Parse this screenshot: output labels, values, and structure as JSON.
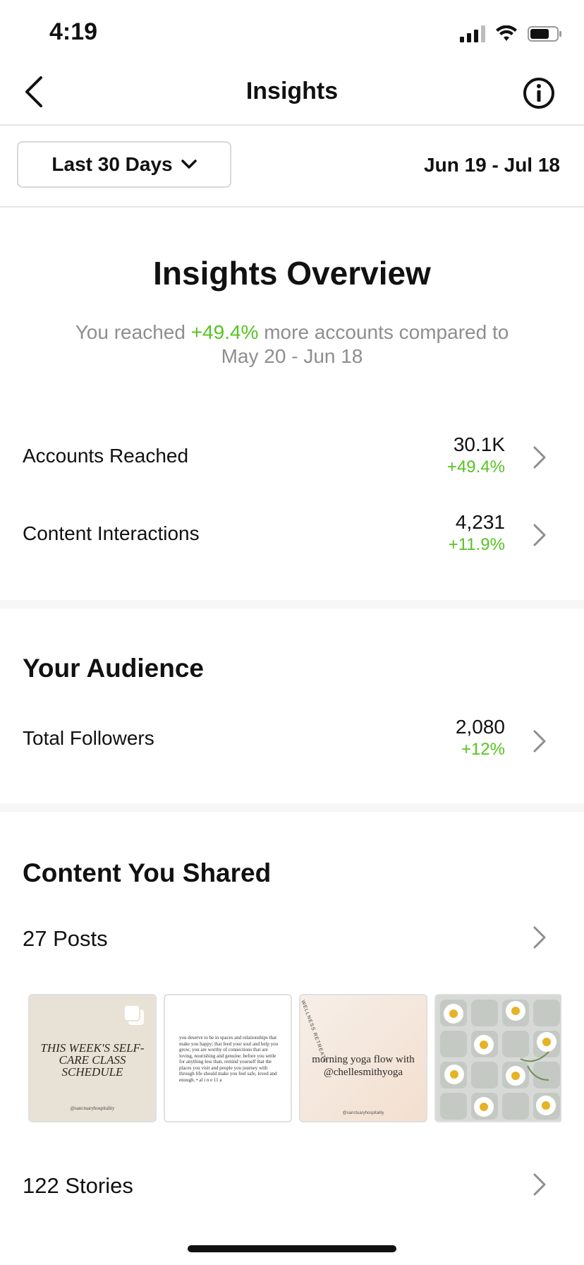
{
  "status_bar": {
    "time": "4:19"
  },
  "header": {
    "title": "Insights"
  },
  "filter": {
    "period_label": "Last 30 Days",
    "date_range": "Jun 19 - Jul 18"
  },
  "overview": {
    "title": "Insights Overview",
    "subtitle_prefix": "You reached ",
    "subtitle_change": "+49.4%",
    "subtitle_suffix": " more accounts compared to",
    "subtitle_compare": "May 20 - Jun 18"
  },
  "metrics": [
    {
      "label": "Accounts Reached",
      "value": "30.1K",
      "change": "+49.4%"
    },
    {
      "label": "Content Interactions",
      "value": "4,231",
      "change": "+11.9%"
    }
  ],
  "audience": {
    "title": "Your Audience",
    "followers_label": "Total Followers",
    "followers_value": "2,080",
    "followers_change": "+12%"
  },
  "content": {
    "title": "Content You Shared",
    "posts_label": "27 Posts",
    "stories_label": "122 Stories",
    "thumbs": [
      {
        "headline": "THIS WEEK'S SELF-CARE CLASS SCHEDULE",
        "footer": "@sanctuaryhospitality"
      },
      {
        "text": "you deserve to be in spaces and relationships that make you happy; that feed your soul and help you grow; you are worthy of connections that are loving, nourishing and genuine. before you settle for anything less than, remind yourself that the places you visit and people you journey with through life should make you feel safe, loved and enough. • al i n e 11 a"
      },
      {
        "headline": "morning yoga flow with @chellesmithyoga",
        "arc": "WELLNESS RETREATS",
        "footer": "@sanctuaryhospitality"
      },
      {
        "description": "daisies in ice cube tray"
      }
    ]
  },
  "colors": {
    "positive": "#58c322",
    "muted": "#8e8e8e"
  }
}
